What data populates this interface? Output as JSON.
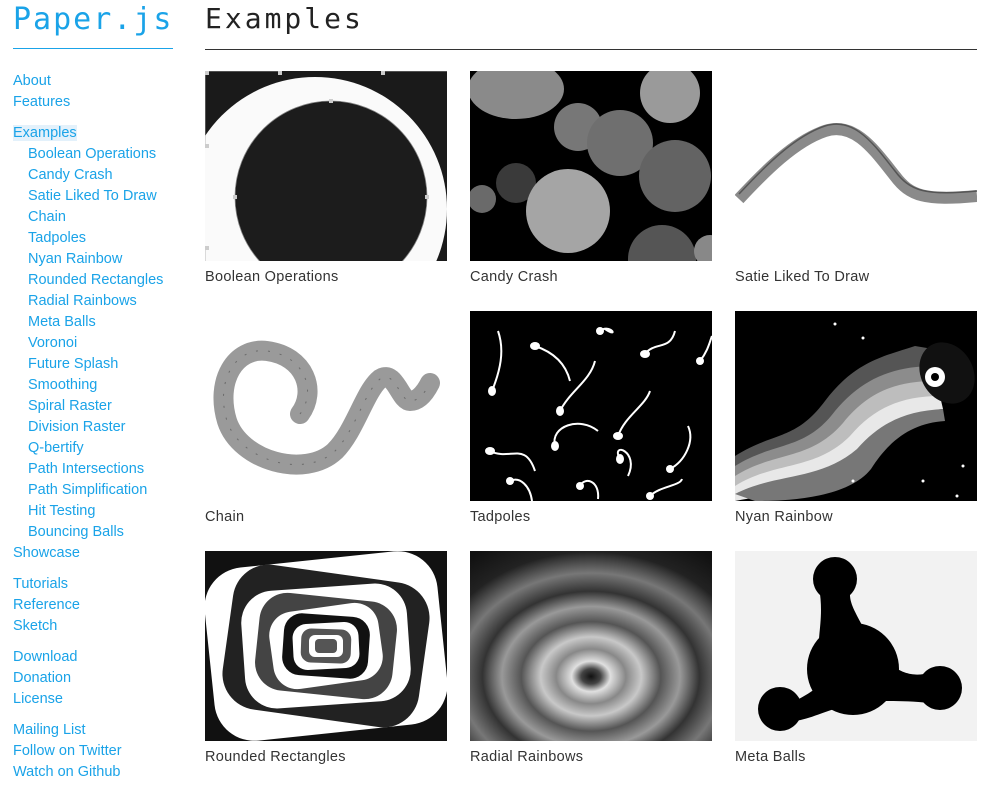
{
  "brand": "Paper.js",
  "page_title": "Examples",
  "nav": [
    {
      "label": "About",
      "gap": false,
      "sub": false,
      "active": false
    },
    {
      "label": "Features",
      "gap": false,
      "sub": false,
      "active": false
    },
    {
      "label": "Examples",
      "gap": true,
      "sub": false,
      "active": true
    },
    {
      "label": "Boolean Operations",
      "gap": false,
      "sub": true,
      "active": false
    },
    {
      "label": "Candy Crash",
      "gap": false,
      "sub": true,
      "active": false
    },
    {
      "label": "Satie Liked To Draw",
      "gap": false,
      "sub": true,
      "active": false
    },
    {
      "label": "Chain",
      "gap": false,
      "sub": true,
      "active": false
    },
    {
      "label": "Tadpoles",
      "gap": false,
      "sub": true,
      "active": false
    },
    {
      "label": "Nyan Rainbow",
      "gap": false,
      "sub": true,
      "active": false
    },
    {
      "label": "Rounded Rectangles",
      "gap": false,
      "sub": true,
      "active": false
    },
    {
      "label": "Radial Rainbows",
      "gap": false,
      "sub": true,
      "active": false
    },
    {
      "label": "Meta Balls",
      "gap": false,
      "sub": true,
      "active": false
    },
    {
      "label": "Voronoi",
      "gap": false,
      "sub": true,
      "active": false
    },
    {
      "label": "Future Splash",
      "gap": false,
      "sub": true,
      "active": false
    },
    {
      "label": "Smoothing",
      "gap": false,
      "sub": true,
      "active": false
    },
    {
      "label": "Spiral Raster",
      "gap": false,
      "sub": true,
      "active": false
    },
    {
      "label": "Division Raster",
      "gap": false,
      "sub": true,
      "active": false
    },
    {
      "label": "Q-bertify",
      "gap": false,
      "sub": true,
      "active": false
    },
    {
      "label": "Path Intersections",
      "gap": false,
      "sub": true,
      "active": false
    },
    {
      "label": "Path Simplification",
      "gap": false,
      "sub": true,
      "active": false
    },
    {
      "label": "Hit Testing",
      "gap": false,
      "sub": true,
      "active": false
    },
    {
      "label": "Bouncing Balls",
      "gap": false,
      "sub": true,
      "active": false
    },
    {
      "label": "Showcase",
      "gap": false,
      "sub": false,
      "active": false
    },
    {
      "label": "Tutorials",
      "gap": true,
      "sub": false,
      "active": false
    },
    {
      "label": "Reference",
      "gap": false,
      "sub": false,
      "active": false
    },
    {
      "label": "Sketch",
      "gap": false,
      "sub": false,
      "active": false
    },
    {
      "label": "Download",
      "gap": true,
      "sub": false,
      "active": false
    },
    {
      "label": "Donation",
      "gap": false,
      "sub": false,
      "active": false
    },
    {
      "label": "License",
      "gap": false,
      "sub": false,
      "active": false
    },
    {
      "label": "Mailing List",
      "gap": true,
      "sub": false,
      "active": false
    },
    {
      "label": "Follow on Twitter",
      "gap": false,
      "sub": false,
      "active": false
    },
    {
      "label": "Watch on Github",
      "gap": false,
      "sub": false,
      "active": false
    }
  ],
  "examples": [
    {
      "caption": "Boolean Operations",
      "thumb": "boolean-operations-thumbnail"
    },
    {
      "caption": "Candy Crash",
      "thumb": "candy-crash-thumbnail"
    },
    {
      "caption": "Satie Liked To Draw",
      "thumb": "satie-liked-to-draw-thumbnail"
    },
    {
      "caption": "Chain",
      "thumb": "chain-thumbnail"
    },
    {
      "caption": "Tadpoles",
      "thumb": "tadpoles-thumbnail"
    },
    {
      "caption": "Nyan Rainbow",
      "thumb": "nyan-rainbow-thumbnail"
    },
    {
      "caption": "Rounded Rectangles",
      "thumb": "rounded-rectangles-thumbnail"
    },
    {
      "caption": "Radial Rainbows",
      "thumb": "radial-rainbows-thumbnail"
    },
    {
      "caption": "Meta Balls",
      "thumb": "meta-balls-thumbnail"
    }
  ],
  "colors": {
    "link": "#1aa3e8",
    "active_highlight": "#e3f1fb",
    "heading": "#222222",
    "caption": "#333333"
  }
}
